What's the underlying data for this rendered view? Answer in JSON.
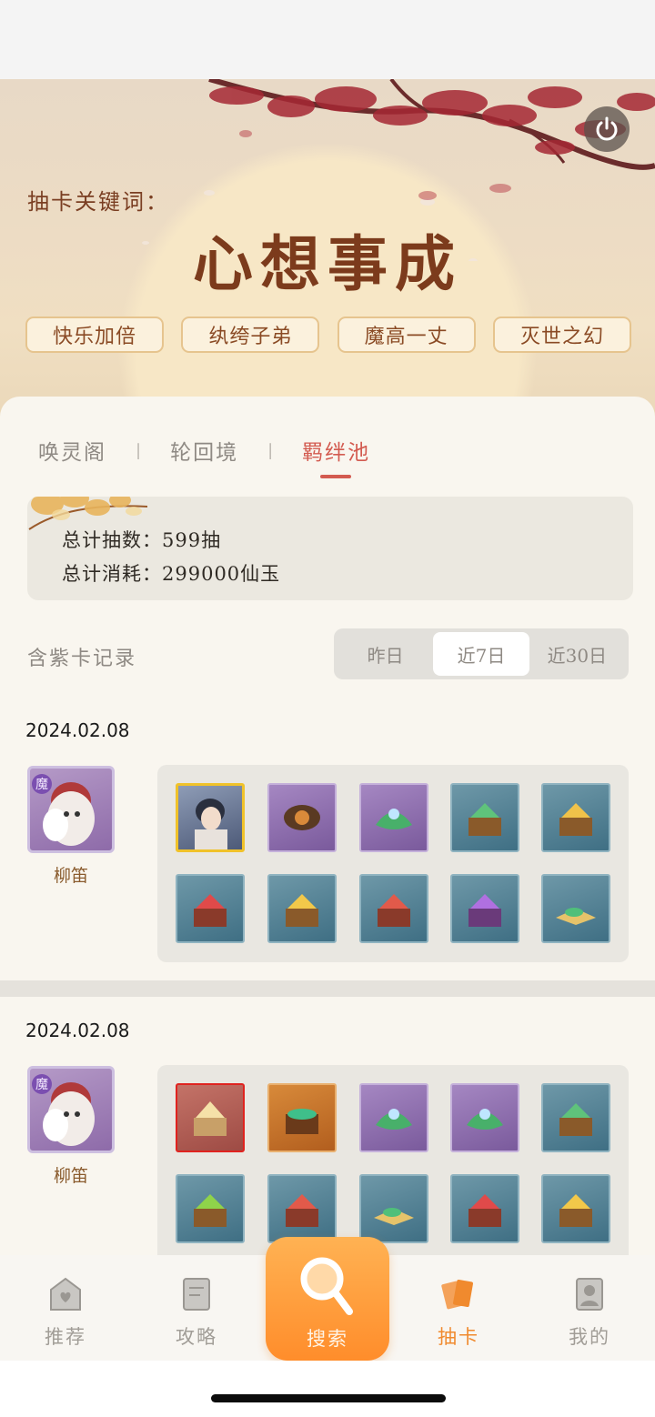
{
  "hero": {
    "keyword_label": "抽卡关键词：",
    "keyword": "心想事成",
    "chips": [
      "快乐加倍",
      "纨绔子弟",
      "魔高一丈",
      "灭世之幻"
    ],
    "power_icon": "power-icon"
  },
  "tabs": {
    "items": [
      "唤灵阁",
      "轮回境",
      "羁绊池"
    ],
    "separator": "|",
    "active_index": 2
  },
  "stats": {
    "total_draws": "总计抽数：599抽",
    "total_cost": "总计消耗：299000仙玉"
  },
  "records": {
    "title": "含紫卡记录",
    "ranges": [
      "昨日",
      "近7日",
      "近30日"
    ],
    "selected_range": "近7日",
    "entries": [
      {
        "date": "2024.02.08",
        "character_name": "柳笛",
        "character_tag": "魔",
        "items": [
          "portrait",
          "purple",
          "purple",
          "blue",
          "blue",
          "blue",
          "blue",
          "blue",
          "blue",
          "blue"
        ]
      },
      {
        "date": "2024.02.08",
        "character_name": "柳笛",
        "character_tag": "魔",
        "items": [
          "red",
          "gold",
          "purple",
          "purple",
          "blue",
          "blue",
          "blue",
          "blue",
          "blue",
          "blue"
        ]
      }
    ]
  },
  "nav": {
    "items": [
      {
        "label": "推荐",
        "icon": "heart-house-icon"
      },
      {
        "label": "攻略",
        "icon": "book-icon"
      },
      {
        "label": "搜索",
        "icon": "search-icon"
      },
      {
        "label": "抽卡",
        "icon": "cards-icon"
      },
      {
        "label": "我的",
        "icon": "profile-icon"
      }
    ],
    "active_index": 3
  },
  "colors": {
    "accent_red": "#d35b50",
    "accent_orange": "#f08a2e",
    "title_brown": "#7c3b1c"
  }
}
